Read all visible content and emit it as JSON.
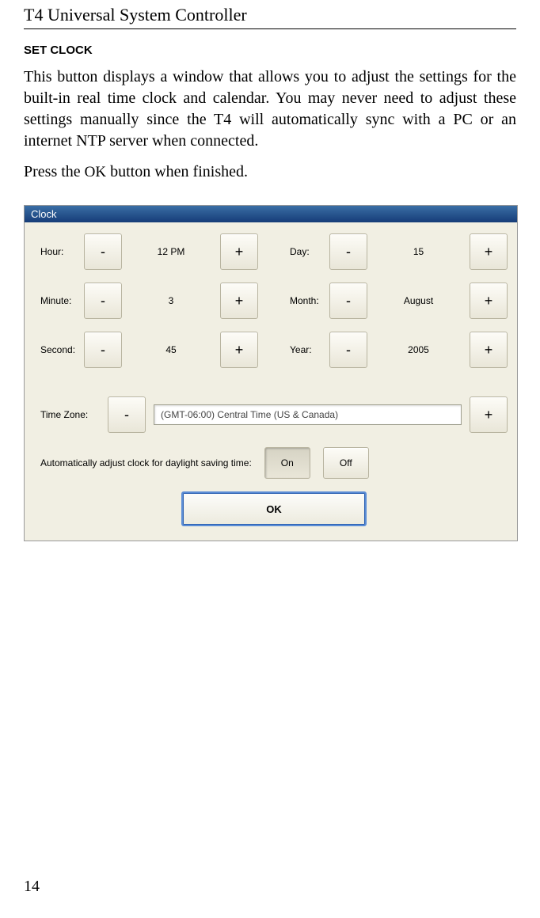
{
  "header": "T4 Universal System Controller",
  "section_title": "SET CLOCK",
  "paragraph1": "This button displays a window that allows you to adjust the settings for the built-in real time clock and calendar. You may never need to adjust these settings manually since the  T4 will automatically sync with a PC or an internet NTP server when connected.",
  "paragraph2_pre": "Press the ",
  "paragraph2_ok": "OK",
  "paragraph2_post": " button when finished.",
  "page_number": "14",
  "dialog": {
    "title": "Clock",
    "minus": "-",
    "plus": "+",
    "left_rows": [
      {
        "label": "Hour:",
        "value": "12 PM"
      },
      {
        "label": "Minute:",
        "value": "3"
      },
      {
        "label": "Second:",
        "value": "45"
      }
    ],
    "right_rows": [
      {
        "label": "Day:",
        "value": "15"
      },
      {
        "label": "Month:",
        "value": "August"
      },
      {
        "label": "Year:",
        "value": "2005"
      }
    ],
    "tz_label": "Time Zone:",
    "tz_value": "(GMT-06:00) Central Time (US & Canada)",
    "dst_label": "Automatically adjust clock for daylight saving time:",
    "dst_on": "On",
    "dst_off": "Off",
    "ok": "OK"
  }
}
